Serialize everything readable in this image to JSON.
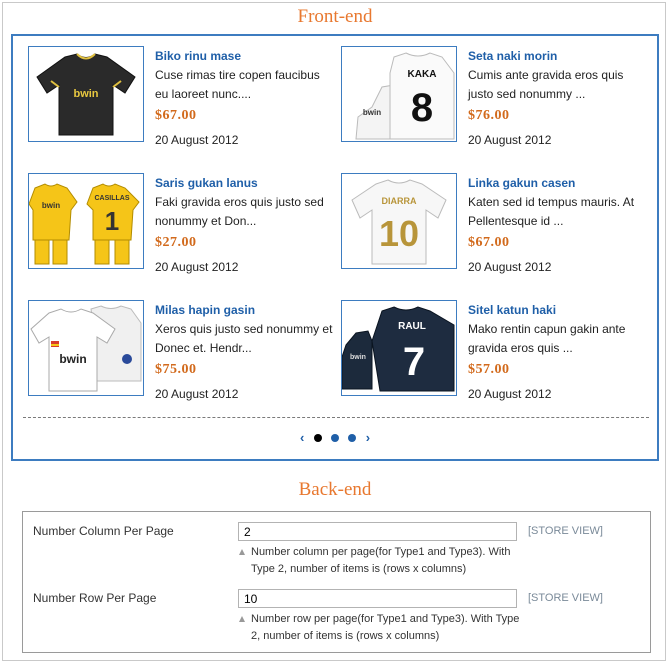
{
  "frontend_title": "Front-end",
  "backend_title": "Back-end",
  "products": [
    {
      "name": "Biko rinu mase",
      "desc": "Cuse rimas tire copen faucibus eu laoreet nunc....",
      "price": "$67.00",
      "date": "20 August 2012"
    },
    {
      "name": "Seta naki morin",
      "desc": "Cumis ante gravida eros quis justo sed nonummy ...",
      "price": "$76.00",
      "date": "20 August 2012"
    },
    {
      "name": "Saris gukan lanus",
      "desc": "Faki gravida eros quis justo sed nonummy et Don...",
      "price": "$27.00",
      "date": "20 August 2012"
    },
    {
      "name": "Linka gakun casen",
      "desc": "Katen sed id tempus mauris. At Pellentesque id ...",
      "price": "$67.00",
      "date": "20 August 2012"
    },
    {
      "name": "Milas hapin gasin",
      "desc": "Xeros quis justo sed nonummy et Donec et. Hendr...",
      "price": "$75.00",
      "date": "20 August 2012"
    },
    {
      "name": "Sitel katun haki",
      "desc": "Mako rentin capun gakin ante gravida eros quis ...",
      "price": "$57.00",
      "date": "20 August 2012"
    }
  ],
  "jersey_text": {
    "sponsor": "bwin",
    "kaka_name": "KAKA",
    "kaka_number": "8",
    "casillas_name": "CASILLAS",
    "casillas_number": "1",
    "diarra_name": "DIARRA",
    "diarra_number": "10",
    "raul_name": "RAUL",
    "raul_number": "7"
  },
  "pager": {
    "prev": "‹",
    "next": "›",
    "pages": 3,
    "active": 1
  },
  "settings": [
    {
      "label": "Number Column Per Page",
      "value": "2",
      "scope": "[STORE VIEW]",
      "note": "Number column per page(for Type1 and Type3). With Type 2, number of items is (rows x columns)"
    },
    {
      "label": "Number Row Per Page",
      "value": "10",
      "scope": "[STORE VIEW]",
      "note": "Number row per page(for Type1 and Type3). With Type 2, number of items is (rows x columns)"
    }
  ],
  "colors": {
    "accent_orange": "#e8782f",
    "link_blue": "#1f5fa8",
    "price_orange": "#d26a1c",
    "border_blue": "#3d7cc0"
  }
}
